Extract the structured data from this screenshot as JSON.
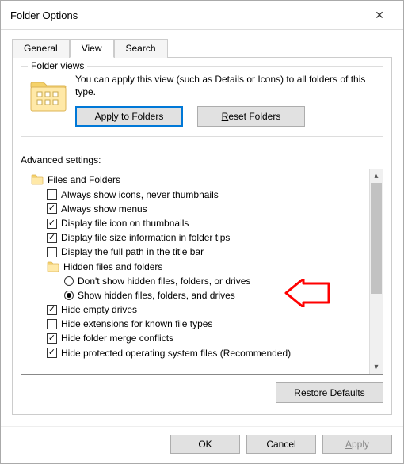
{
  "window": {
    "title": "Folder Options",
    "close": "✕"
  },
  "tabs": {
    "general": "General",
    "view": "View",
    "search": "Search"
  },
  "folder_views": {
    "legend": "Folder views",
    "description": "You can apply this view (such as Details or Icons) to all folders of this type.",
    "apply_btn": "Apply to Folders",
    "reset_btn": "Reset Folders"
  },
  "advanced": {
    "label": "Advanced settings:",
    "root": "Files and Folders",
    "items": [
      {
        "label": "Always show icons, never thumbnails",
        "checked": false
      },
      {
        "label": "Always show menus",
        "checked": true
      },
      {
        "label": "Display file icon on thumbnails",
        "checked": true
      },
      {
        "label": "Display file size information in folder tips",
        "checked": true
      },
      {
        "label": "Display the full path in the title bar",
        "checked": false
      }
    ],
    "hidden_group": "Hidden files and folders",
    "hidden_options": [
      {
        "label": "Don't show hidden files, folders, or drives",
        "selected": false
      },
      {
        "label": "Show hidden files, folders, and drives",
        "selected": true
      }
    ],
    "items2": [
      {
        "label": "Hide empty drives",
        "checked": true
      },
      {
        "label": "Hide extensions for known file types",
        "checked": false
      },
      {
        "label": "Hide folder merge conflicts",
        "checked": true
      },
      {
        "label": "Hide protected operating system files (Recommended)",
        "checked": true
      }
    ]
  },
  "restore_defaults": "Restore Defaults",
  "buttons": {
    "ok": "OK",
    "cancel": "Cancel",
    "apply": "Apply"
  }
}
